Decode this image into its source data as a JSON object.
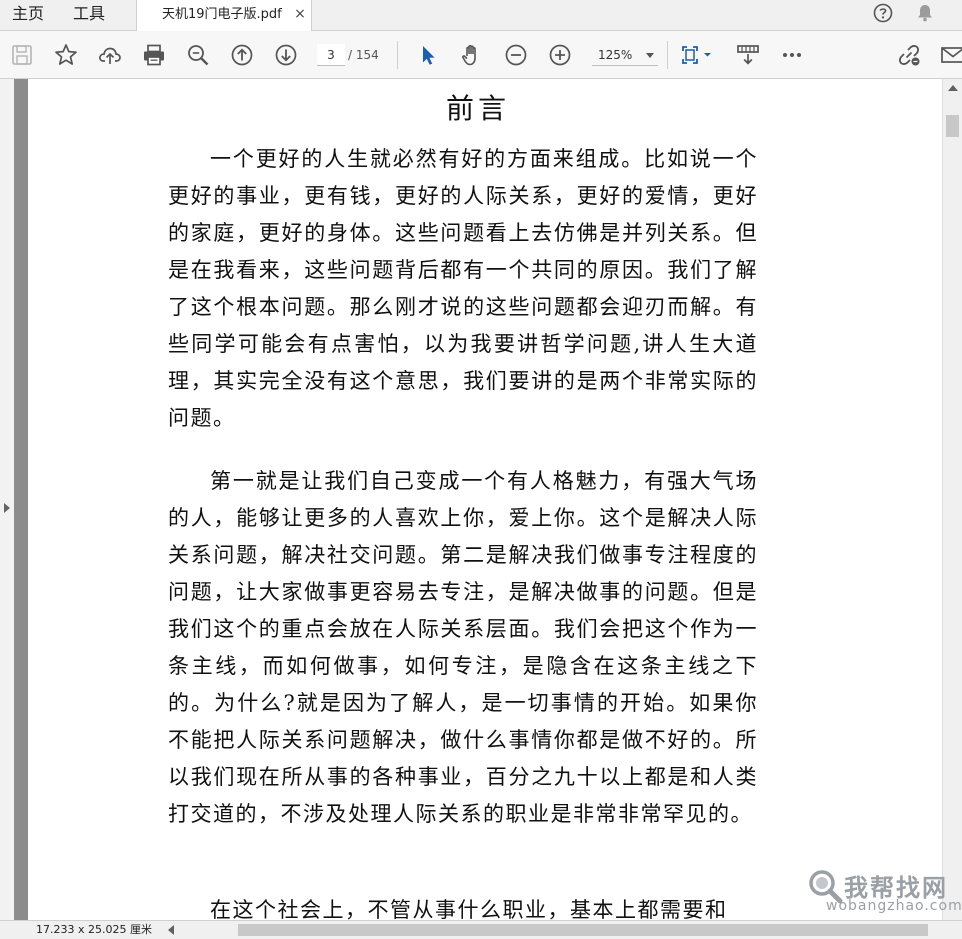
{
  "menu": {
    "home": "主页",
    "tools": "工具"
  },
  "tab": {
    "title": "天机19门电子版.pdf",
    "close": "×"
  },
  "icons": {
    "help": "help-icon",
    "notifications": "bell-icon",
    "save": "save-icon",
    "bookmark": "star-icon",
    "upload": "cloud-upload-icon",
    "print": "printer-icon",
    "zoom_search": "zoom-search-icon",
    "prev_page": "arrow-up-circle-icon",
    "next_page": "arrow-down-circle-icon",
    "select": "cursor-icon",
    "hand": "hand-icon",
    "zoom_out": "zoom-out-icon",
    "zoom_in": "zoom-in-icon",
    "fit": "fit-page-icon",
    "scroll_mode": "scroll-mode-icon",
    "more": "more-icon",
    "link": "link-icon",
    "email": "email-icon"
  },
  "toolbar": {
    "page_current": "3",
    "page_total": "/ 154",
    "zoom": "125%"
  },
  "document": {
    "heading": "前言",
    "paragraphs": [
      "一个更好的人生就必然有好的方面来组成。比如说一个更好的事业，更有钱，更好的人际关系，更好的爱情，更好的家庭，更好的身体。这些问题看上去仿佛是并列关系。但是在我看来，这些问题背后都有一个共同的原因。我们了解了这个根本问题。那么刚才说的这些问题都会迎刃而解。有些同学可能会有点害怕，以为我要讲哲学问题,讲人生大道理，其实完全没有这个意思，我们要讲的是两个非常实际的问题。",
      "第一就是让我们自己变成一个有人格魅力，有强大气场的人，能够让更多的人喜欢上你，爱上你。这个是解决人际关系问题，解决社交问题。第二是解决我们做事专注程度的问题，让大家做事更容易去专注，是解决做事的问题。但是我们这个的重点会放在人际关系层面。我们会把这个作为一条主线，而如何做事，如何专注，是隐含在这条主线之下的。为什么?就是因为了解人，是一切事情的开始。如果你不能把人际关系问题解决，做什么事情你都是做不好的。所以我们现在所从事的各种事业，百分之九十以上都是和人类打交道的，不涉及处理人际关系的职业是非常非常罕见的。",
      "在这个社会上，不管从事什么职业，基本上都需要和"
    ]
  },
  "status": {
    "page_size": "17.233 x 25.025 厘米"
  },
  "watermark": {
    "text": "我帮找网",
    "url": "wobangzhao.com"
  },
  "colors": {
    "accent_blue": "#1a5fb4",
    "icon_gray": "#555555",
    "page_shadow": "#8c8c8c"
  }
}
